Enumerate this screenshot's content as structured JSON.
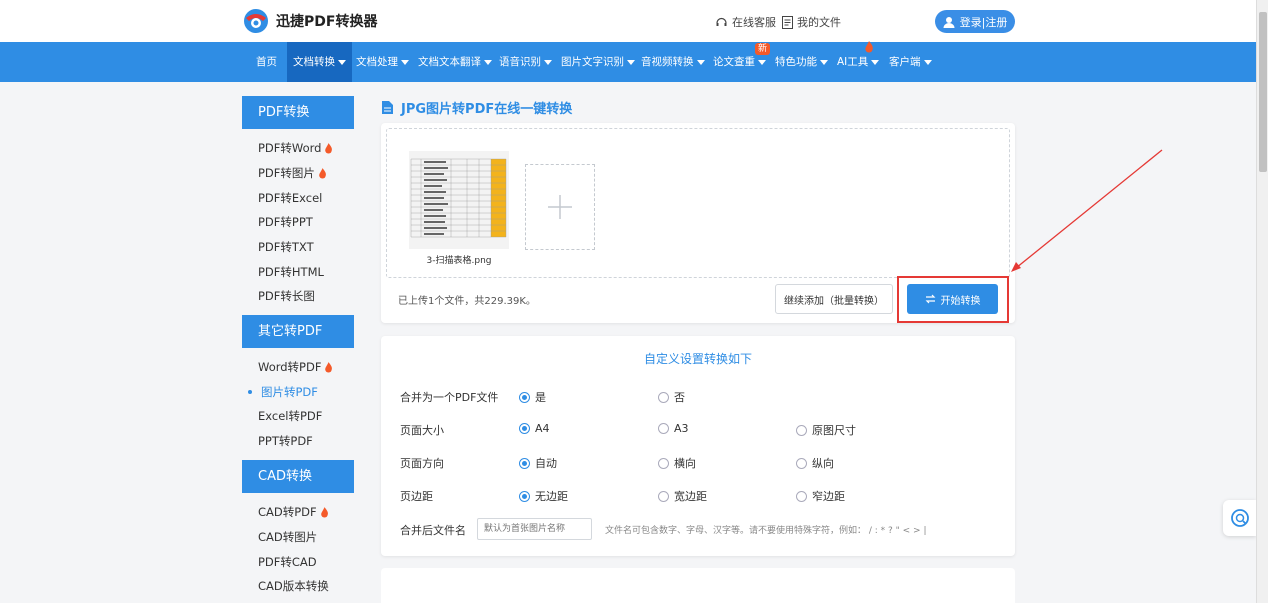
{
  "header": {
    "logo_text": "迅捷PDF转换器",
    "online_service": "在线客服",
    "my_files": "我的文件",
    "login": "登录|注册"
  },
  "nav": {
    "items": [
      {
        "label": "首页",
        "has_caret": false
      },
      {
        "label": "文档转换",
        "has_caret": true,
        "active": true
      },
      {
        "label": "文档处理",
        "has_caret": true
      },
      {
        "label": "文档文本翻译",
        "has_caret": true
      },
      {
        "label": "语音识别",
        "has_caret": true
      },
      {
        "label": "图片文字识别",
        "has_caret": true
      },
      {
        "label": "音视频转换",
        "has_caret": true
      },
      {
        "label": "论文查重",
        "has_caret": true,
        "badge": "新"
      },
      {
        "label": "特色功能",
        "has_caret": true
      },
      {
        "label": "AI工具",
        "has_caret": true,
        "flame": true
      },
      {
        "label": "客户端",
        "has_caret": true
      }
    ]
  },
  "sidebar": {
    "groups": [
      {
        "title": "PDF转换",
        "items": [
          {
            "label": "PDF转Word",
            "hot": true
          },
          {
            "label": "PDF转图片",
            "hot": true
          },
          {
            "label": "PDF转Excel"
          },
          {
            "label": "PDF转PPT"
          },
          {
            "label": "PDF转TXT"
          },
          {
            "label": "PDF转HTML"
          },
          {
            "label": "PDF转长图"
          }
        ]
      },
      {
        "title": "其它转PDF",
        "items": [
          {
            "label": "Word转PDF",
            "hot": true
          },
          {
            "label": "图片转PDF",
            "active": true
          },
          {
            "label": "Excel转PDF"
          },
          {
            "label": "PPT转PDF"
          }
        ]
      },
      {
        "title": "CAD转换",
        "items": [
          {
            "label": "CAD转PDF",
            "hot": true
          },
          {
            "label": "CAD转图片"
          },
          {
            "label": "PDF转CAD"
          },
          {
            "label": "CAD版本转换"
          }
        ]
      }
    ]
  },
  "main": {
    "title": "JPG图片转PDF在线一键转换",
    "file_name": "3-扫描表格.png",
    "status": "已上传1个文件，共229.39K。",
    "add_more": "继续添加（批量转换）",
    "start": "开始转换"
  },
  "settings": {
    "title": "自定义设置转换如下",
    "rows": [
      {
        "label": "合并为一个PDF文件",
        "options": [
          {
            "text": "是",
            "on": true
          },
          {
            "text": "否"
          }
        ]
      },
      {
        "label": "页面大小",
        "options": [
          {
            "text": "A4",
            "on": true
          },
          {
            "text": "A3"
          },
          {
            "text": "原图尺寸"
          }
        ]
      },
      {
        "label": "页面方向",
        "options": [
          {
            "text": "自动",
            "on": true
          },
          {
            "text": "横向"
          },
          {
            "text": "纵向"
          }
        ]
      },
      {
        "label": "页边距",
        "options": [
          {
            "text": "无边距",
            "on": true
          },
          {
            "text": "宽边距"
          },
          {
            "text": "窄边距"
          }
        ]
      }
    ],
    "filename_label": "合并后文件名",
    "filename_placeholder": "默认为首张图片名称",
    "filename_note": "文件名可包含数字、字母、汉字等。请不要使用特殊字符，例如： / : * ? \" < > |"
  },
  "colors": {
    "primary": "#2f8de4",
    "nav_active": "#1768c0",
    "highlight": "#e53935"
  }
}
